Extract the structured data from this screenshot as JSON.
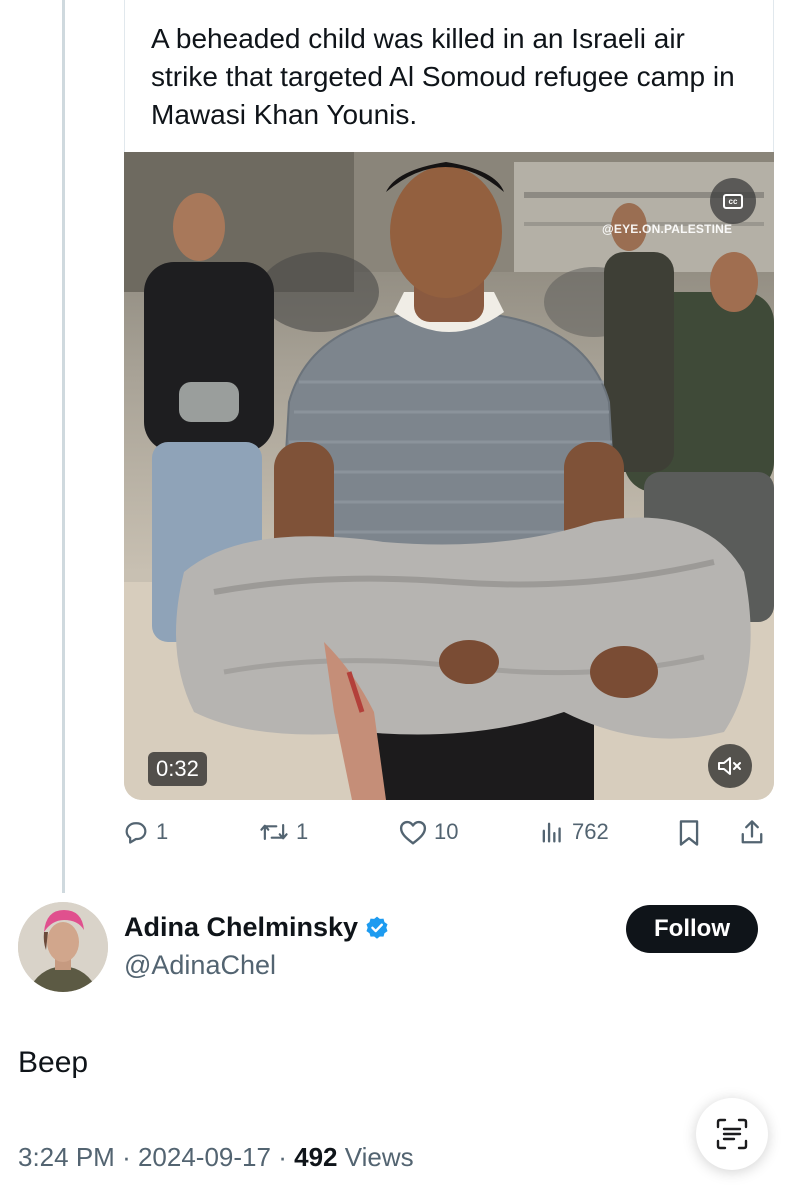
{
  "quoted_tweet": {
    "text": "A beheaded child was killed in an Israeli air strike that targeted Al Somoud refugee camp in Mawasi Khan Younis.",
    "video": {
      "watermark": "@EYE.ON.PALESTINE",
      "duration": "0:32",
      "captions_icon": "cc-icon",
      "mute_icon": "speaker-muted-icon"
    },
    "actions": {
      "replies": "1",
      "reposts": "1",
      "likes": "10",
      "views": "762"
    }
  },
  "tweet": {
    "author": {
      "name": "Adina Chelminsky",
      "handle": "@AdinaChel",
      "verified": true
    },
    "follow_label": "Follow",
    "text": "Beep",
    "time": "3:24 PM",
    "date": "2024-09-17",
    "separator": "·",
    "views_count": "492",
    "views_label": "Views"
  },
  "colors": {
    "text_primary": "#0f1419",
    "text_secondary": "#536471",
    "verified_blue": "#1d9bf0",
    "thread_line": "#cfd9de"
  }
}
